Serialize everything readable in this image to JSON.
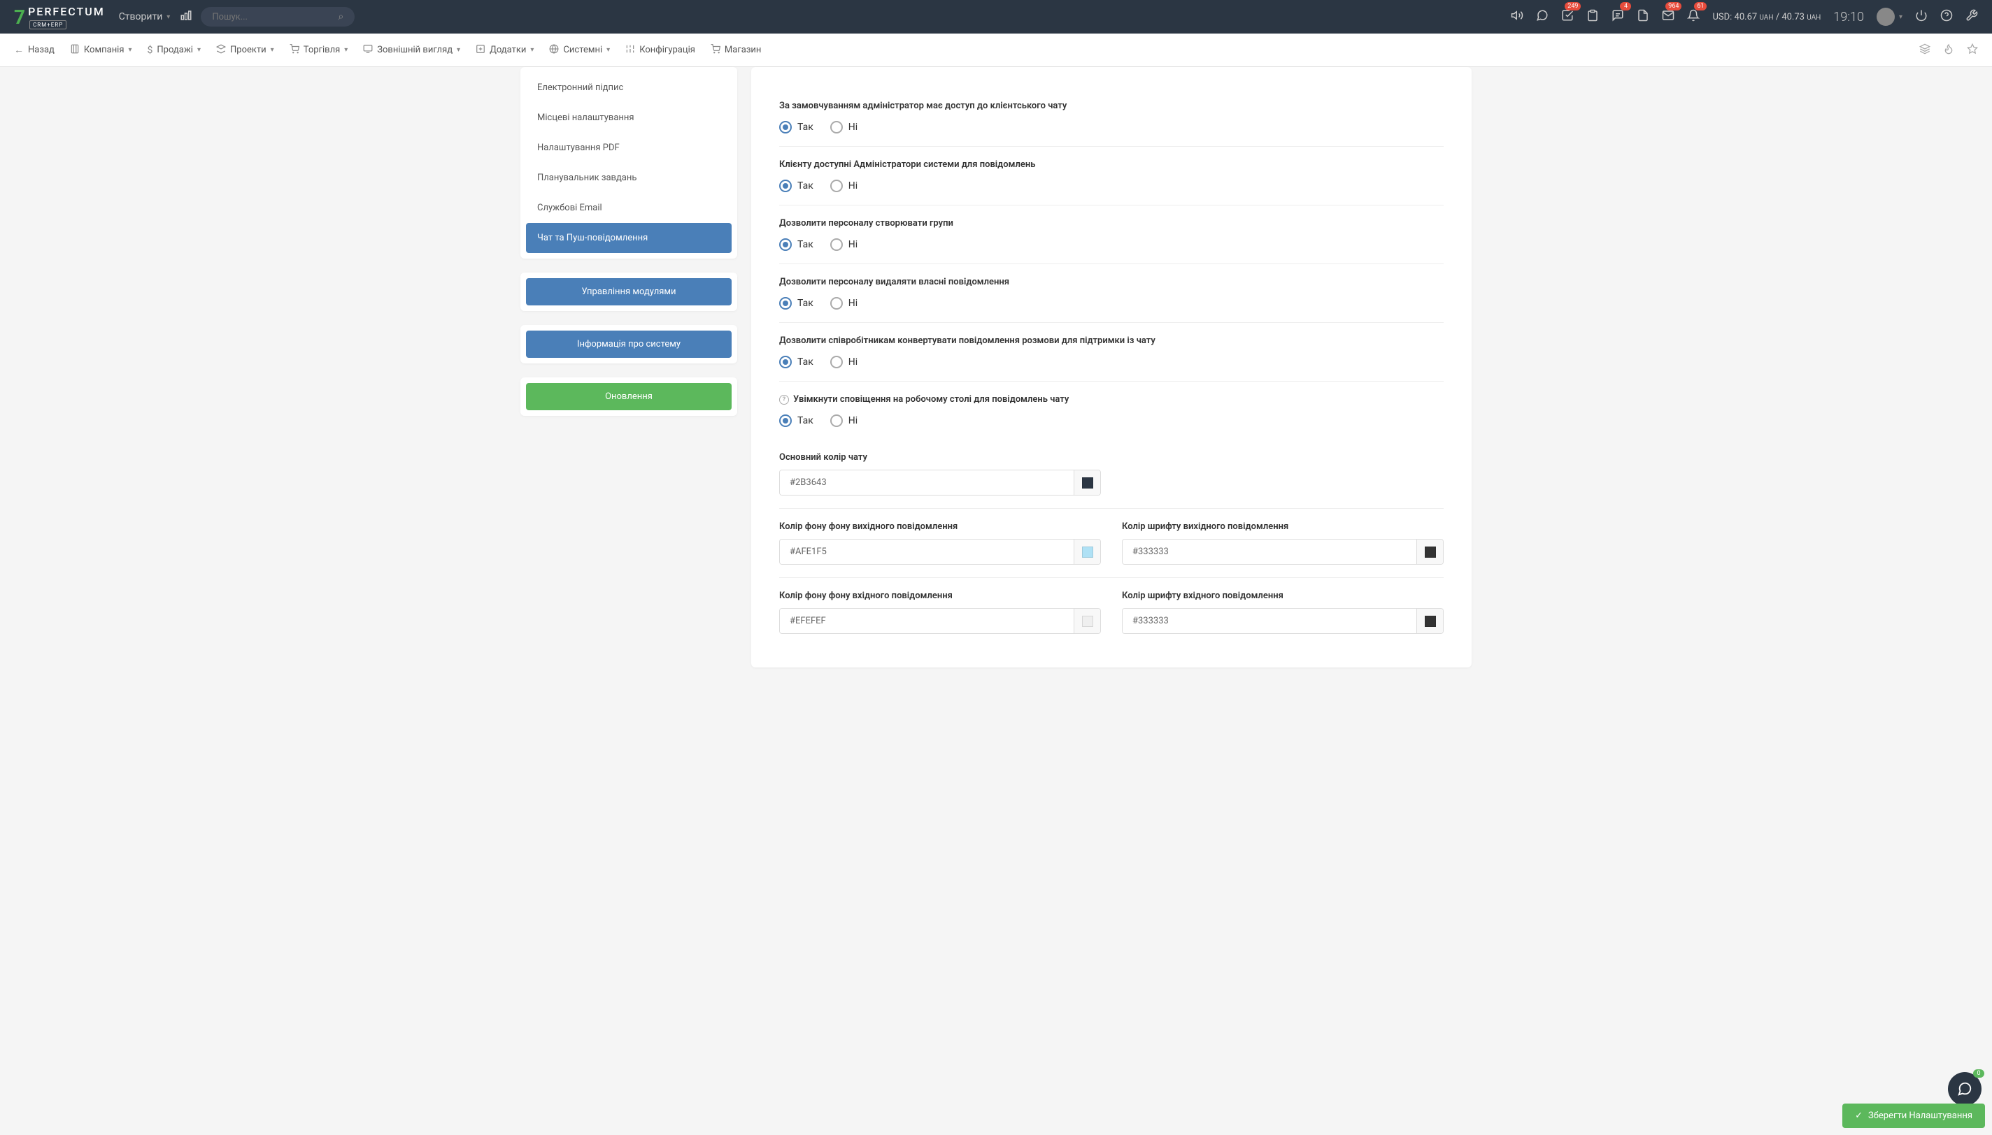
{
  "header": {
    "logo_text": "PERFECTUM",
    "logo_sub": "CRM+ERP",
    "create_label": "Створити",
    "search_placeholder": "Пошук...",
    "badges": {
      "tasks": "249",
      "chat": "4",
      "mail": "964",
      "bell": "61"
    },
    "currency": {
      "prefix": "USD:",
      "buy": "40.67",
      "sell": "40.73",
      "unit": "UAH",
      "sep": "/"
    },
    "time": "19:10",
    "chat_badge": "0"
  },
  "nav": {
    "back": "Назад",
    "items": [
      "Компанія",
      "Продажі",
      "Проекти",
      "Торгівля",
      "Зовнішній вигляд",
      "Додатки",
      "Системні",
      "Конфігурація",
      "Магазин"
    ]
  },
  "sidebar": {
    "items": [
      "Електронний підпис",
      "Місцеві налаштування",
      "Налаштування PDF",
      "Планувальник завдань",
      "Службові Email",
      "Чат та Пуш-повідомлення"
    ],
    "active_index": 5,
    "btn_modules": "Управління модулями",
    "btn_info": "Інформація про систему",
    "btn_update": "Оновлення"
  },
  "radio_labels": {
    "yes": "Так",
    "no": "Ні"
  },
  "settings": [
    {
      "label": "За замовчуванням адміністратор має доступ до клієнтського чату",
      "value": "yes"
    },
    {
      "label": "Клієнту доступні Адміністратори системи для повідомлень",
      "value": "yes"
    },
    {
      "label": "Дозволити персоналу створювати групи",
      "value": "yes"
    },
    {
      "label": "Дозволити персоналу видаляти власні повідомлення",
      "value": "yes"
    },
    {
      "label": "Дозволити співробітникам конвертувати повідомлення розмови для підтримки із чату",
      "value": "yes"
    },
    {
      "label": "Увімкнути сповіщення на робочому столі для повідомлень чату",
      "value": "yes",
      "help": true
    }
  ],
  "colors": {
    "main": {
      "label": "Основний колір чату",
      "value": "#2B3643"
    },
    "out_bg": {
      "label": "Колір фону фону вихідного повідомлення",
      "value": "#AFE1F5"
    },
    "out_font": {
      "label": "Колір шрифту вихідного повідомлення",
      "value": "#333333"
    },
    "in_bg": {
      "label": "Колір фону фону вхідного повідомлення",
      "value": "#EFEFEF"
    },
    "in_font": {
      "label": "Колір шрифту вхідного повідомлення",
      "value": "#333333"
    }
  },
  "save_label": "Зберегти Налаштування"
}
